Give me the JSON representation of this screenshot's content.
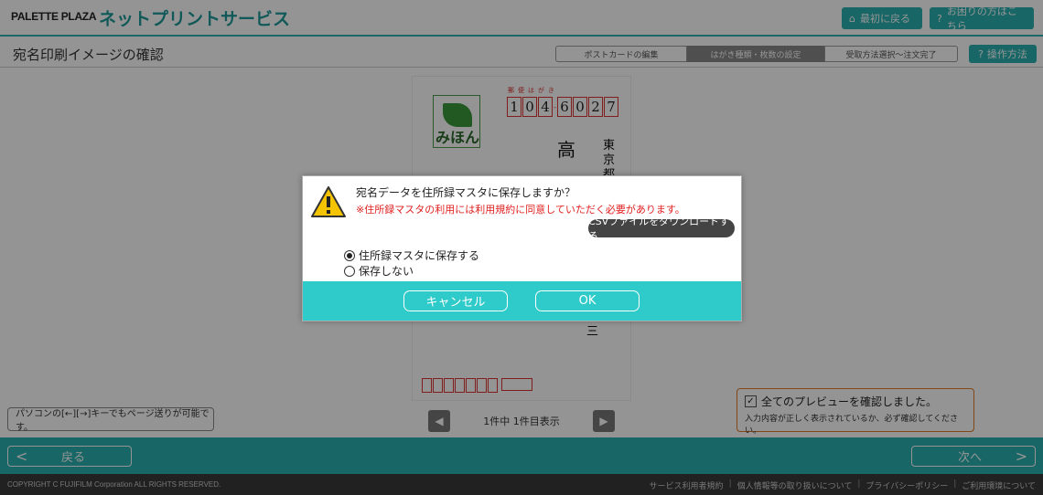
{
  "header": {
    "logo": "PALETTE PLAZA",
    "service_title": "ネットプリントサービス",
    "home_button": "最初に戻る",
    "help_button": "お困りの方はこちら"
  },
  "subheader": {
    "page_title": "宛名印刷イメージの確認",
    "steps": [
      "ポストカードの編集",
      "はがき種類・枚数の設定",
      "受取方法選択〜注文完了"
    ],
    "active_step": 1,
    "howto_button": "操作方法"
  },
  "postcard": {
    "label": "郵便はがき",
    "zip_digits": [
      "1",
      "0",
      "4",
      "6",
      "0",
      "2",
      "7"
    ],
    "stamp_text": "みほん",
    "name_char": "高",
    "address_chars": [
      "東",
      "京",
      "都"
    ],
    "bottom_char": "三"
  },
  "main": {
    "hint": "パソコンの[←][→]キーでもページ送りが可能です。",
    "page_info": "1件中 1件目表示",
    "confirm_label": "全てのプレビューを確認しました。",
    "confirm_sub": "入力内容が正しく表示されているか、必ず確認してください。",
    "confirm_checked": true
  },
  "nav": {
    "back": "戻る",
    "next": "次へ"
  },
  "footer": {
    "copyright": "COPYRIGHT C FUJIFILM Corporation ALL RIGHTS RESERVED.",
    "links": [
      "サービス利用者規約",
      "個人情報等の取り扱いについて",
      "プライバシーポリシー",
      "ご利用環境について"
    ]
  },
  "modal": {
    "question": "宛名データを住所録マスタに保存しますか？",
    "warning": "※住所録マスタの利用には利用規約に同意していただく必要があります。",
    "csv_button": "CSVファイルをダウンロードする",
    "options": [
      "住所録マスタに保存する",
      "保存しない"
    ],
    "selected_option": 0,
    "cancel": "キャンセル",
    "ok": "OK"
  },
  "colors": {
    "accent": "#2ab0b0",
    "warning_text": "#e02020",
    "confirm_border": "#e07a28"
  }
}
